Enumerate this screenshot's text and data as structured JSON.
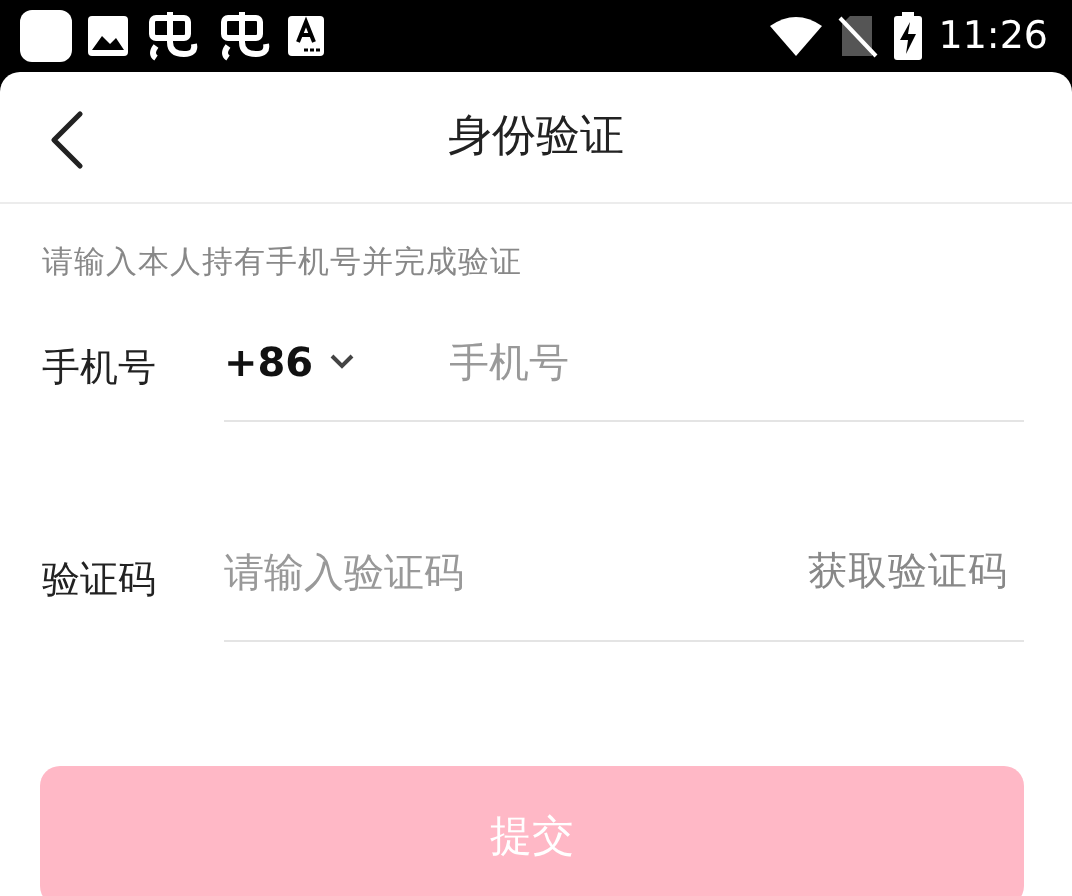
{
  "status_bar": {
    "time": "11:26"
  },
  "header": {
    "title": "身份验证"
  },
  "hint": "请输入本人持有手机号并完成验证",
  "phone": {
    "label": "手机号",
    "country_code": "+86",
    "placeholder": "手机号"
  },
  "code": {
    "label": "验证码",
    "placeholder": "请输入验证码",
    "get_code": "获取验证码"
  },
  "submit": {
    "label": "提交",
    "disabled": true
  }
}
